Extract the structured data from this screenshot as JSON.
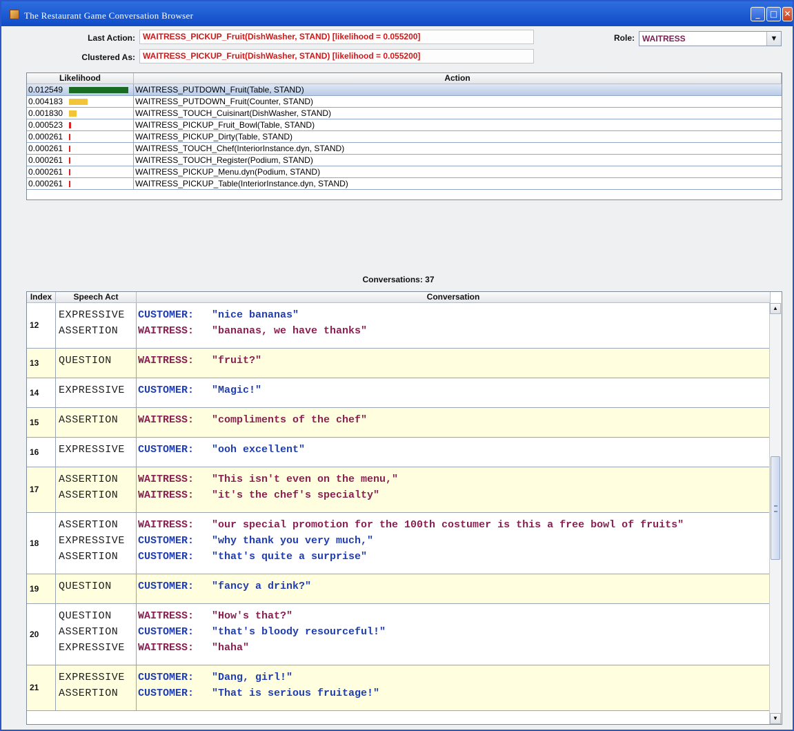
{
  "window": {
    "title": "The Restaurant Game Conversation Browser"
  },
  "top": {
    "last_action_label": "Last Action:",
    "last_action_value": "WAITRESS_PICKUP_Fruit(DishWasher, STAND) [likelihood = 0.055200]",
    "clustered_as_label": "Clustered As:",
    "clustered_as_value": "WAITRESS_PICKUP_Fruit(DishWasher, STAND) [likelihood = 0.055200]",
    "role_label": "Role:",
    "role_value": "WAITRESS"
  },
  "actions_table": {
    "headers": {
      "likelihood": "Likelihood",
      "action": "Action"
    },
    "rows": [
      {
        "likelihood": "0.012549",
        "bar_fraction": 0.95,
        "bar_color": "#1a6b22",
        "action": "WAITRESS_PUTDOWN_Fruit(Table, STAND)"
      },
      {
        "likelihood": "0.004183",
        "bar_fraction": 0.3,
        "bar_color": "#f2c43a",
        "action": "WAITRESS_PUTDOWN_Fruit(Counter, STAND)"
      },
      {
        "likelihood": "0.001830",
        "bar_fraction": 0.12,
        "bar_color": "#f2c43a",
        "action": "WAITRESS_TOUCH_Cuisinart(DishWasher, STAND)"
      },
      {
        "likelihood": "0.000523",
        "bar_fraction": 0.03,
        "bar_color": "#e02020",
        "action": "WAITRESS_PICKUP_Fruit_Bowl(Table, STAND)"
      },
      {
        "likelihood": "0.000261",
        "bar_fraction": 0.02,
        "bar_color": "#e02020",
        "action": "WAITRESS_PICKUP_Dirty(Table, STAND)"
      },
      {
        "likelihood": "0.000261",
        "bar_fraction": 0.02,
        "bar_color": "#e02020",
        "action": "WAITRESS_TOUCH_Chef(InteriorInstance.dyn, STAND)"
      },
      {
        "likelihood": "0.000261",
        "bar_fraction": 0.02,
        "bar_color": "#e02020",
        "action": "WAITRESS_TOUCH_Register(Podium, STAND)"
      },
      {
        "likelihood": "0.000261",
        "bar_fraction": 0.02,
        "bar_color": "#e02020",
        "action": "WAITRESS_PICKUP_Menu.dyn(Podium, STAND)"
      },
      {
        "likelihood": "0.000261",
        "bar_fraction": 0.02,
        "bar_color": "#e02020",
        "action": "WAITRESS_PICKUP_Table(InteriorInstance.dyn, STAND)"
      }
    ]
  },
  "conversations": {
    "title": "Conversations: 37",
    "headers": {
      "index": "Index",
      "speech_act": "Speech Act",
      "conversation": "Conversation"
    },
    "rows": [
      {
        "index": "12",
        "lines": [
          {
            "act": "EXPRESSIVE",
            "speaker": "CUSTOMER:",
            "utterance": "\"nice bananas\""
          },
          {
            "act": "ASSERTION",
            "speaker": "WAITRESS:",
            "utterance": "\"bananas, we have thanks\""
          }
        ]
      },
      {
        "index": "13",
        "lines": [
          {
            "act": "QUESTION",
            "speaker": "WAITRESS:",
            "utterance": "\"fruit?\""
          }
        ]
      },
      {
        "index": "14",
        "lines": [
          {
            "act": "EXPRESSIVE",
            "speaker": "CUSTOMER:",
            "utterance": "\"Magic!\""
          }
        ]
      },
      {
        "index": "15",
        "lines": [
          {
            "act": "ASSERTION",
            "speaker": "WAITRESS:",
            "utterance": "\"compliments of the chef\""
          }
        ]
      },
      {
        "index": "16",
        "lines": [
          {
            "act": "EXPRESSIVE",
            "speaker": "CUSTOMER:",
            "utterance": "\"ooh excellent\""
          }
        ]
      },
      {
        "index": "17",
        "lines": [
          {
            "act": "ASSERTION",
            "speaker": "WAITRESS:",
            "utterance": "\"This isn't even on the menu,\""
          },
          {
            "act": "ASSERTION",
            "speaker": "WAITRESS:",
            "utterance": "\"it's the chef's specialty\""
          }
        ]
      },
      {
        "index": "18",
        "lines": [
          {
            "act": "ASSERTION",
            "speaker": "WAITRESS:",
            "utterance": "\"our special promotion for the 100th costumer is this a free bowl of fruits\""
          },
          {
            "act": "EXPRESSIVE",
            "speaker": "CUSTOMER:",
            "utterance": "\"why thank you very much,\""
          },
          {
            "act": "ASSERTION",
            "speaker": "CUSTOMER:",
            "utterance": "\"that's quite a surprise\""
          }
        ]
      },
      {
        "index": "19",
        "lines": [
          {
            "act": "QUESTION",
            "speaker": "CUSTOMER:",
            "utterance": "\"fancy a drink?\""
          }
        ]
      },
      {
        "index": "20",
        "lines": [
          {
            "act": "QUESTION",
            "speaker": "WAITRESS:",
            "utterance": "\"How's that?\""
          },
          {
            "act": "ASSERTION",
            "speaker": "CUSTOMER:",
            "utterance": "\"that's bloody resourceful!\""
          },
          {
            "act": "EXPRESSIVE",
            "speaker": "WAITRESS:",
            "utterance": "\"haha\""
          }
        ]
      },
      {
        "index": "21",
        "lines": [
          {
            "act": "EXPRESSIVE",
            "speaker": "CUSTOMER:",
            "utterance": "\"Dang, girl!\""
          },
          {
            "act": "ASSERTION",
            "speaker": "CUSTOMER:",
            "utterance": "\"That is serious fruitage!\""
          }
        ]
      }
    ]
  },
  "icons": {
    "app": "coffee-cup-icon",
    "minimize": "minimize-icon",
    "maximize": "maximize-icon",
    "close": "close-icon",
    "dropdown": "chevron-down-icon",
    "scroll_up": "scroll-up-icon",
    "scroll_down": "scroll-down-icon"
  }
}
